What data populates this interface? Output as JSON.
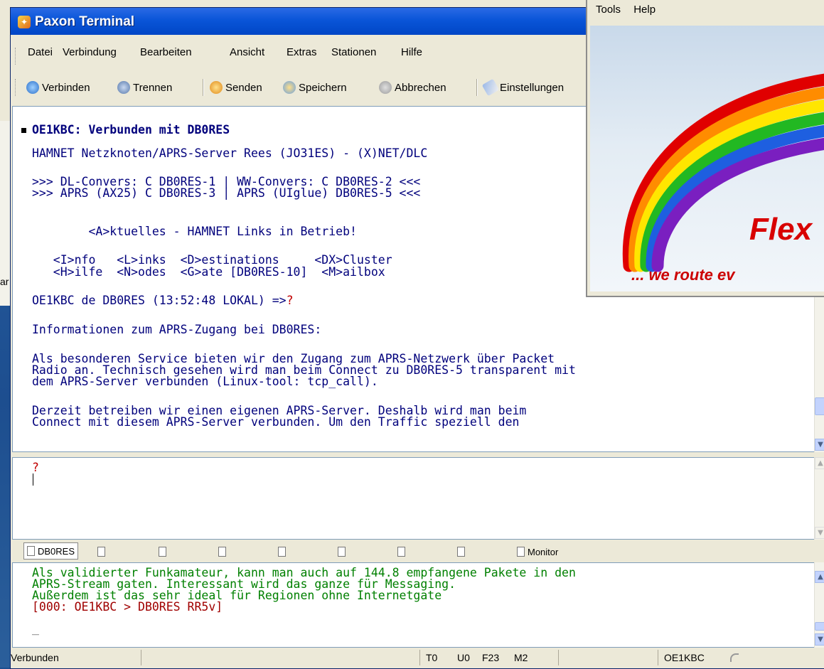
{
  "window": {
    "title": "Paxon Terminal"
  },
  "menu": [
    "Datei",
    "Verbindung",
    "Bearbeiten",
    "Ansicht",
    "Extras",
    "Stationen",
    "Hilfe"
  ],
  "toolbar": {
    "connect": "Verbinden",
    "disconnect": "Trennen",
    "send": "Senden",
    "save": "Speichern",
    "cancel": "Abbrechen",
    "settings": "Einstellungen"
  },
  "terminal": {
    "lines": [
      "OE1KBC: Verbunden mit DB0RES",
      "HAMNET Netzknoten/APRS-Server Rees (JO31ES) - (X)NET/DLC",
      ">>> DL-Convers: C DB0RES-1 | WW-Convers: C DB0RES-2 <<<",
      ">>> APRS (AX25) C DB0RES-3 | APRS (UIglue) DB0RES-5 <<<",
      "        <A>ktuelles - HAMNET Links in Betrieb!",
      "   <I>nfo   <L>inks  <D>estinations     <DX>Cluster",
      "   <H>ilfe  <N>odes  <G>ate [DB0RES-10]  <M>ailbox",
      "OE1KBC de DB0RES (13:52:48 LOKAL) =>",
      "Informationen zum APRS-Zugang bei DB0RES:",
      "Als besonderen Service bieten wir den Zugang zum APRS-Netzwerk über Packet",
      "Radio an. Technisch gesehen wird man beim Connect zu DB0RES-5 transparent mit",
      "dem APRS-Server verbunden (Linux-tool: tcp_call).",
      "Derzeit betreiben wir einen eigenen APRS-Server. Deshalb wird man beim",
      "Connect mit diesem APRS-Server verbunden. Um den Traffic speziell den"
    ],
    "prompt_char": "?"
  },
  "input": {
    "text": "?"
  },
  "tabs": {
    "first": "DB0RES",
    "monitor": "Monitor"
  },
  "monitor": {
    "lines": [
      "Als validierter Funkamateur, kann man auch auf 144.8 empfangene Pakete in den",
      "APRS-Stream gaten. Interessant wird das ganze für Messaging.",
      "Außerdem ist das sehr ideal für Regionen ohne Internetgate"
    ],
    "status_line": "[000: OE1KBC > DB0RES RR5v]",
    "cursor": "_"
  },
  "statusbar": {
    "state": "Verbunden",
    "t": "T0",
    "u": "U0",
    "f": "F23",
    "m": "M2",
    "call": "OE1KBC"
  },
  "flexnet": {
    "menu": [
      "Tools",
      "Help"
    ],
    "logo": "Flex",
    "tagline": "... we route ev"
  },
  "background": {
    "fragment": "ar"
  },
  "colors": {
    "terminal_text": "#00007c",
    "monitor_text": "#008000",
    "alert": "#c00000",
    "titlebar": "#0a55d8"
  }
}
